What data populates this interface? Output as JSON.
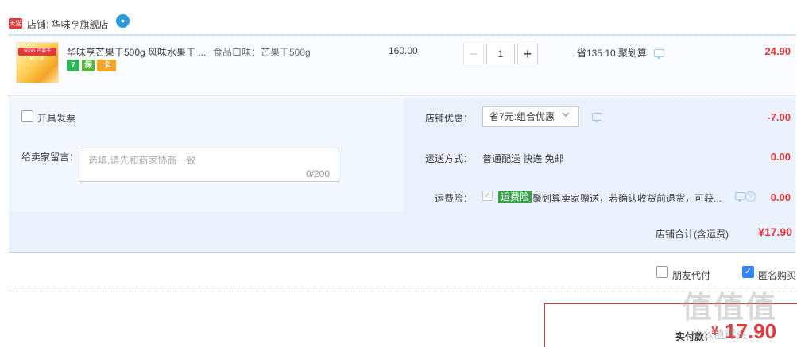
{
  "shop": {
    "logo_text": "天猫",
    "label": "店铺: 华味亨旗舰店",
    "wangwang_icon": "wangwang-chat-icon"
  },
  "item": {
    "thumb_band": "500G 芒果干 ¥17.90",
    "title": "华味亨芒果干500g 风味水果干 ...",
    "sku": "食品口味：芒果干500g",
    "badges": [
      "7",
      "保",
      "卡"
    ],
    "price": "160.00",
    "quantity": "1",
    "minus_label": "−",
    "plus_label": "+",
    "promo": "省135.10:聚划算",
    "total": "24.90"
  },
  "options": {
    "invoice_label": "开具发票",
    "message_label": "给卖家留言：",
    "message_placeholder": "选填,请先和商家协商一致",
    "message_count": "0/200",
    "discount_label": "店铺优惠：",
    "discount_selected": "省7元:组合优惠",
    "discount_amount": "-7.00",
    "shipping_label": "运送方式：",
    "shipping_value": "普通配送 快递 免邮",
    "shipping_amount": "0.00",
    "insurance_label": "运费险：",
    "insurance_tag": "运费险",
    "insurance_text": "聚划算卖家赠送，若确认收货前退货，可获...",
    "insurance_amount": "0.00",
    "help_glyph": "?"
  },
  "summary": {
    "label": "店铺合计(含运费)",
    "value": "¥17.90"
  },
  "footer": {
    "friend_pay_label": "朋友代付",
    "anonymous_label": "匿名购买",
    "anonymous_checked": true,
    "pay_label": "实付款：",
    "pay_currency": "¥",
    "pay_value": "17.90"
  },
  "watermark": {
    "text": "值值值",
    "sub": "什么值得买"
  },
  "colors": {
    "accent_red": "#e4393c",
    "panel_blue": "#f2f7ff",
    "checkbox_blue": "#3385ff",
    "insurance_green": "#3aa04c"
  }
}
